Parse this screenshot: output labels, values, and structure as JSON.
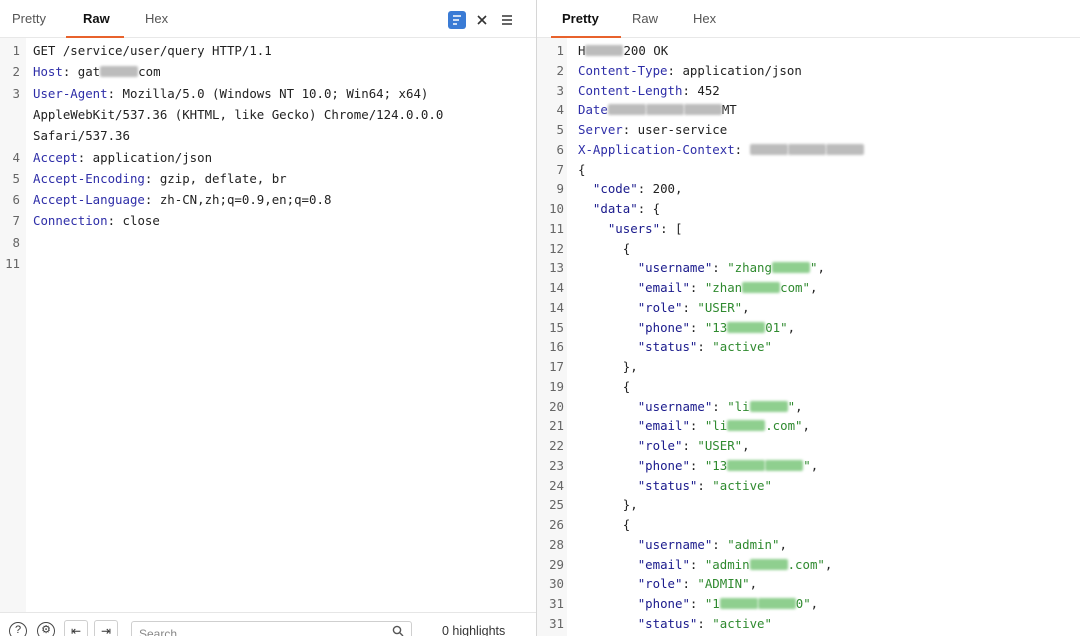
{
  "request": {
    "tabs": [
      "Pretty",
      "Raw",
      "Hex"
    ],
    "active_tab": "Raw",
    "icons": [
      "wrap-lines-icon",
      "collapse-icon",
      "menu-icon"
    ],
    "lines": [
      {
        "n": "1",
        "parts": [
          {
            "t": "GET /service/user/query HTTP/1.1",
            "c": ""
          }
        ]
      },
      {
        "n": "2",
        "parts": [
          {
            "t": "Host",
            "c": "hkey"
          },
          {
            "t": ": gat",
            "c": ""
          },
          {
            "b": "grey"
          },
          {
            "t": "com",
            "c": ""
          }
        ]
      },
      {
        "n": "3",
        "parts": [
          {
            "t": "User-Agent",
            "c": "hkey"
          },
          {
            "t": ": Mozilla/5.0 (Windows NT 10.0; Win64; x64)",
            "c": ""
          }
        ]
      },
      {
        "n": "",
        "parts": [
          {
            "t": "AppleWebKit/537.36 (KHTML, like Gecko) Chrome/124.0.0.0",
            "c": ""
          }
        ]
      },
      {
        "n": "",
        "parts": [
          {
            "t": "Safari/537.36",
            "c": ""
          }
        ]
      },
      {
        "n": "4",
        "parts": [
          {
            "t": "Accept",
            "c": "hkey"
          },
          {
            "t": ": application/json",
            "c": ""
          }
        ]
      },
      {
        "n": "5",
        "parts": [
          {
            "t": "Accept-Encoding",
            "c": "hkey"
          },
          {
            "t": ": gzip, deflate, br",
            "c": ""
          }
        ]
      },
      {
        "n": "6",
        "parts": [
          {
            "t": "Accept-Language",
            "c": "hkey"
          },
          {
            "t": ": zh-CN,zh;q=0.9,en;q=0.8",
            "c": ""
          }
        ]
      },
      {
        "n": "7",
        "parts": [
          {
            "t": "Connection",
            "c": "hkey"
          },
          {
            "t": ": close",
            "c": ""
          }
        ]
      },
      {
        "n": "8",
        "parts": []
      },
      {
        "n": "11",
        "parts": []
      }
    ],
    "search_placeholder": "Search...",
    "highlights": "0 highlights",
    "bottom_icons": [
      "help-icon",
      "settings-icon",
      "previous-match-icon",
      "next-match-icon",
      "search-icon"
    ]
  },
  "response": {
    "tabs": [
      "Pretty",
      "Raw",
      "Hex"
    ],
    "active_tab": "Pretty",
    "lines": [
      {
        "n": "1",
        "parts": [
          {
            "t": "H",
            "c": ""
          },
          {
            "b": "grey"
          },
          {
            "t": "200 OK",
            "c": ""
          }
        ]
      },
      {
        "n": "2",
        "parts": [
          {
            "t": "Content-Type",
            "c": "hkey"
          },
          {
            "t": ": application/json",
            "c": ""
          }
        ]
      },
      {
        "n": "3",
        "parts": [
          {
            "t": "Content-Length",
            "c": "hkey"
          },
          {
            "t": ": 452",
            "c": ""
          }
        ]
      },
      {
        "n": "4",
        "parts": [
          {
            "t": "Date",
            "c": "hkey"
          },
          {
            "b": "grey"
          },
          {
            "b": "grey"
          },
          {
            "b": "grey"
          },
          {
            "t": "MT",
            "c": ""
          }
        ]
      },
      {
        "n": "5",
        "parts": [
          {
            "t": "Server",
            "c": "hkey"
          },
          {
            "t": ": user-service",
            "c": ""
          }
        ]
      },
      {
        "n": "6",
        "parts": [
          {
            "t": "X-Application-Context",
            "c": "hkey"
          },
          {
            "t": ": ",
            "c": ""
          },
          {
            "b": "grey"
          },
          {
            "b": "grey"
          },
          {
            "b": "grey"
          }
        ]
      },
      {
        "n": "7",
        "parts": [
          {
            "t": "{",
            "c": ""
          }
        ]
      },
      {
        "n": "9",
        "parts": [
          {
            "t": "  ",
            "c": ""
          },
          {
            "t": "\"code\"",
            "c": "jkey"
          },
          {
            "t": ": 200,",
            "c": ""
          }
        ]
      },
      {
        "n": "10",
        "parts": [
          {
            "t": "  ",
            "c": ""
          },
          {
            "t": "\"data\"",
            "c": "jkey"
          },
          {
            "t": ": {",
            "c": ""
          }
        ]
      },
      {
        "n": "11",
        "parts": [
          {
            "t": "    ",
            "c": ""
          },
          {
            "t": "\"users\"",
            "c": "jkey"
          },
          {
            "t": ": [",
            "c": ""
          }
        ]
      },
      {
        "n": "12",
        "parts": [
          {
            "t": "      {",
            "c": ""
          }
        ]
      },
      {
        "n": "13",
        "parts": [
          {
            "t": "        ",
            "c": ""
          },
          {
            "t": "\"username\"",
            "c": "jkey"
          },
          {
            "t": ": ",
            "c": ""
          },
          {
            "t": "\"zhang",
            "c": "jstr"
          },
          {
            "b": "green"
          },
          {
            "t": "\"",
            "c": "jstr"
          },
          {
            "t": ",",
            "c": ""
          }
        ]
      },
      {
        "n": "14",
        "parts": [
          {
            "t": "        ",
            "c": ""
          },
          {
            "t": "\"email\"",
            "c": "jkey"
          },
          {
            "t": ": ",
            "c": ""
          },
          {
            "t": "\"zhan",
            "c": "jstr"
          },
          {
            "b": "green"
          },
          {
            "t": "com\"",
            "c": "jstr"
          },
          {
            "t": ",",
            "c": ""
          }
        ]
      },
      {
        "n": "14",
        "parts": [
          {
            "t": "        ",
            "c": ""
          },
          {
            "t": "\"role\"",
            "c": "jkey"
          },
          {
            "t": ": ",
            "c": ""
          },
          {
            "t": "\"USER\"",
            "c": "jstr"
          },
          {
            "t": ",",
            "c": ""
          }
        ]
      },
      {
        "n": "15",
        "parts": [
          {
            "t": "        ",
            "c": ""
          },
          {
            "t": "\"phone\"",
            "c": "jkey"
          },
          {
            "t": ": ",
            "c": ""
          },
          {
            "t": "\"13",
            "c": "jstr"
          },
          {
            "b": "green"
          },
          {
            "t": "01\"",
            "c": "jstr"
          },
          {
            "t": ",",
            "c": ""
          }
        ]
      },
      {
        "n": "16",
        "parts": [
          {
            "t": "        ",
            "c": ""
          },
          {
            "t": "\"status\"",
            "c": "jkey"
          },
          {
            "t": ": ",
            "c": ""
          },
          {
            "t": "\"active\"",
            "c": "jstr"
          }
        ]
      },
      {
        "n": "17",
        "parts": [
          {
            "t": "      },",
            "c": ""
          }
        ]
      },
      {
        "n": "19",
        "parts": [
          {
            "t": "      {",
            "c": ""
          }
        ]
      },
      {
        "n": "20",
        "parts": [
          {
            "t": "        ",
            "c": ""
          },
          {
            "t": "\"username\"",
            "c": "jkey"
          },
          {
            "t": ": ",
            "c": ""
          },
          {
            "t": "\"li",
            "c": "jstr"
          },
          {
            "b": "green"
          },
          {
            "t": "\"",
            "c": "jstr"
          },
          {
            "t": ",",
            "c": ""
          }
        ]
      },
      {
        "n": "21",
        "parts": [
          {
            "t": "        ",
            "c": ""
          },
          {
            "t": "\"email\"",
            "c": "jkey"
          },
          {
            "t": ": ",
            "c": ""
          },
          {
            "t": "\"li",
            "c": "jstr"
          },
          {
            "b": "green"
          },
          {
            "t": ".com\"",
            "c": "jstr"
          },
          {
            "t": ",",
            "c": ""
          }
        ]
      },
      {
        "n": "22",
        "parts": [
          {
            "t": "        ",
            "c": ""
          },
          {
            "t": "\"role\"",
            "c": "jkey"
          },
          {
            "t": ": ",
            "c": ""
          },
          {
            "t": "\"USER\"",
            "c": "jstr"
          },
          {
            "t": ",",
            "c": ""
          }
        ]
      },
      {
        "n": "23",
        "parts": [
          {
            "t": "        ",
            "c": ""
          },
          {
            "t": "\"phone\"",
            "c": "jkey"
          },
          {
            "t": ": ",
            "c": ""
          },
          {
            "t": "\"13",
            "c": "jstr"
          },
          {
            "b": "green"
          },
          {
            "b": "green"
          },
          {
            "t": "\"",
            "c": "jstr"
          },
          {
            "t": ",",
            "c": ""
          }
        ]
      },
      {
        "n": "24",
        "parts": [
          {
            "t": "        ",
            "c": ""
          },
          {
            "t": "\"status\"",
            "c": "jkey"
          },
          {
            "t": ": ",
            "c": ""
          },
          {
            "t": "\"active\"",
            "c": "jstr"
          }
        ]
      },
      {
        "n": "25",
        "parts": [
          {
            "t": "      },",
            "c": ""
          }
        ]
      },
      {
        "n": "26",
        "parts": [
          {
            "t": "      {",
            "c": ""
          }
        ]
      },
      {
        "n": "28",
        "parts": [
          {
            "t": "        ",
            "c": ""
          },
          {
            "t": "\"username\"",
            "c": "jkey"
          },
          {
            "t": ": ",
            "c": ""
          },
          {
            "t": "\"admin\"",
            "c": "jstr"
          },
          {
            "t": ",",
            "c": ""
          }
        ]
      },
      {
        "n": "29",
        "parts": [
          {
            "t": "        ",
            "c": ""
          },
          {
            "t": "\"email\"",
            "c": "jkey"
          },
          {
            "t": ": ",
            "c": ""
          },
          {
            "t": "\"admin",
            "c": "jstr"
          },
          {
            "b": "green"
          },
          {
            "t": ".com\"",
            "c": "jstr"
          },
          {
            "t": ",",
            "c": ""
          }
        ]
      },
      {
        "n": "30",
        "parts": [
          {
            "t": "        ",
            "c": ""
          },
          {
            "t": "\"role\"",
            "c": "jkey"
          },
          {
            "t": ": ",
            "c": ""
          },
          {
            "t": "\"ADMIN\"",
            "c": "jstr"
          },
          {
            "t": ",",
            "c": ""
          }
        ]
      },
      {
        "n": "31",
        "parts": [
          {
            "t": "        ",
            "c": ""
          },
          {
            "t": "\"phone\"",
            "c": "jkey"
          },
          {
            "t": ": ",
            "c": ""
          },
          {
            "t": "\"1",
            "c": "jstr"
          },
          {
            "b": "green"
          },
          {
            "b": "green"
          },
          {
            "t": "0\"",
            "c": "jstr"
          },
          {
            "t": ",",
            "c": ""
          }
        ]
      },
      {
        "n": "31",
        "parts": [
          {
            "t": "        ",
            "c": ""
          },
          {
            "t": "\"status\"",
            "c": "jkey"
          },
          {
            "t": ": ",
            "c": ""
          },
          {
            "t": "\"active\"",
            "c": "jstr"
          }
        ]
      }
    ]
  },
  "colors": {
    "accent": "#e8622c",
    "header_key": "#2e2ea8",
    "json_string": "#2f8a2f",
    "active_icon_bg": "#3a7bd5"
  }
}
